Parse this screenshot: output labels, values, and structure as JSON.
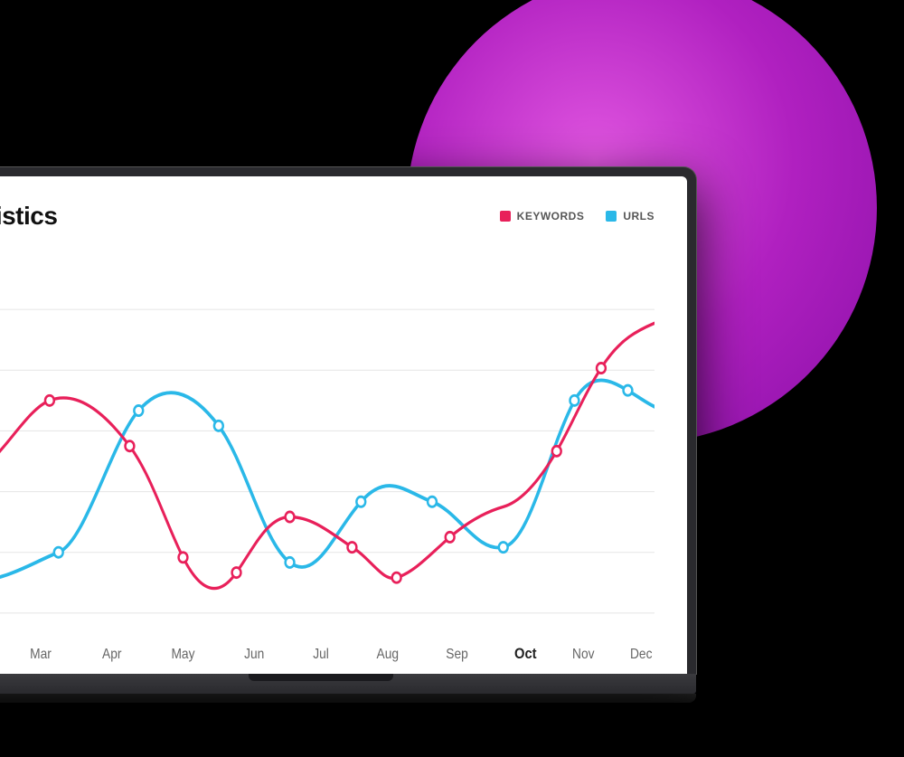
{
  "background": "#000000",
  "decorative": {
    "circle_color_from": "#e055e0",
    "circle_color_to": "#8a10a8"
  },
  "screen": {
    "title": "tistics",
    "legend": {
      "keywords_label": "KEYWORDS",
      "urls_label": "URLS",
      "keywords_color": "#e8205a",
      "urls_color": "#2ab8e8"
    },
    "x_axis_labels": [
      "Mar",
      "Apr",
      "May",
      "Jun",
      "Jul",
      "Aug",
      "Sep",
      "Oct",
      "Nov",
      "Dec"
    ],
    "chart": {
      "keywords_line_color": "#e8205a",
      "urls_line_color": "#2ab8e8",
      "grid_color": "#e8e8e8"
    }
  }
}
